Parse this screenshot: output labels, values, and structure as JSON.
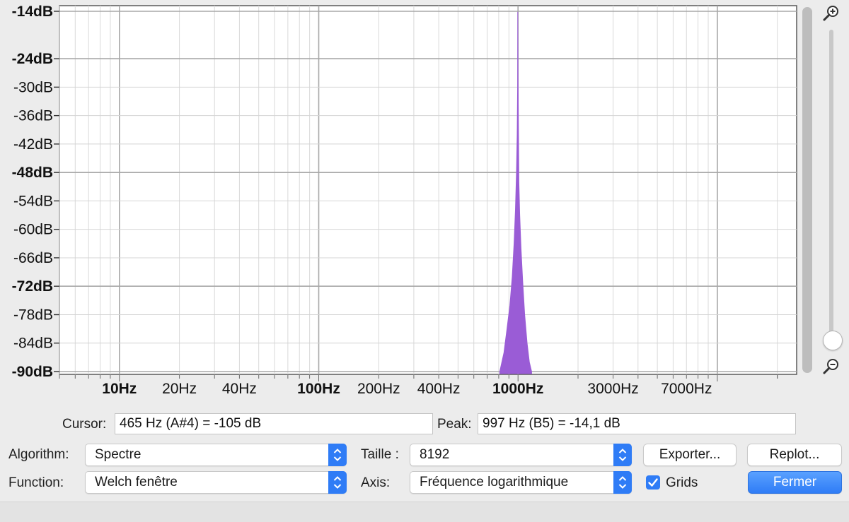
{
  "chart_data": {
    "type": "area",
    "x_scale": "log",
    "xlim": [
      5,
      25000
    ],
    "ylim": [
      -90,
      -14
    ],
    "grid": true,
    "y_tick_labels": [
      {
        "value": -14,
        "label": "-14dB",
        "major": true
      },
      {
        "value": -24,
        "label": "-24dB",
        "major": true
      },
      {
        "value": -30,
        "label": "-30dB",
        "major": false
      },
      {
        "value": -36,
        "label": "-36dB",
        "major": false
      },
      {
        "value": -42,
        "label": "-42dB",
        "major": false
      },
      {
        "value": -48,
        "label": "-48dB",
        "major": true
      },
      {
        "value": -54,
        "label": "-54dB",
        "major": false
      },
      {
        "value": -60,
        "label": "-60dB",
        "major": false
      },
      {
        "value": -66,
        "label": "-66dB",
        "major": false
      },
      {
        "value": -72,
        "label": "-72dB",
        "major": true
      },
      {
        "value": -78,
        "label": "-78dB",
        "major": false
      },
      {
        "value": -84,
        "label": "-84dB",
        "major": false
      },
      {
        "value": -90,
        "label": "-90dB",
        "major": true
      }
    ],
    "x_tick_labels": [
      {
        "value": 10,
        "label": "10Hz",
        "major": true
      },
      {
        "value": 20,
        "label": "20Hz",
        "major": false
      },
      {
        "value": 40,
        "label": "40Hz",
        "major": false
      },
      {
        "value": 100,
        "label": "100Hz",
        "major": true
      },
      {
        "value": 200,
        "label": "200Hz",
        "major": false
      },
      {
        "value": 400,
        "label": "400Hz",
        "major": false
      },
      {
        "value": 1000,
        "label": "1000Hz",
        "major": true
      },
      {
        "value": 3000,
        "label": "3000Hz",
        "major": false
      },
      {
        "value": 7000,
        "label": "7000Hz",
        "major": false
      }
    ],
    "spectrum_points": [
      {
        "x": 810,
        "y": -90
      },
      {
        "x": 850,
        "y": -86
      },
      {
        "x": 880,
        "y": -81
      },
      {
        "x": 910,
        "y": -76
      },
      {
        "x": 935,
        "y": -70
      },
      {
        "x": 955,
        "y": -63
      },
      {
        "x": 970,
        "y": -56
      },
      {
        "x": 982,
        "y": -48
      },
      {
        "x": 990,
        "y": -40
      },
      {
        "x": 995,
        "y": -30
      },
      {
        "x": 997,
        "y": -14.1
      },
      {
        "x": 1000,
        "y": -28
      },
      {
        "x": 1004,
        "y": -37
      },
      {
        "x": 1010,
        "y": -50
      },
      {
        "x": 1020,
        "y": -57
      },
      {
        "x": 1035,
        "y": -64
      },
      {
        "x": 1055,
        "y": -71
      },
      {
        "x": 1080,
        "y": -78
      },
      {
        "x": 1110,
        "y": -84
      },
      {
        "x": 1140,
        "y": -88
      },
      {
        "x": 1170,
        "y": -90
      }
    ],
    "series_color": "#9a5cd6"
  },
  "readout": {
    "cursor_label": "Cursor:",
    "cursor_value": "465 Hz (A#4) = -105 dB",
    "peak_label": "Peak:",
    "peak_value": "997 Hz (B5) = -14,1 dB"
  },
  "controls": {
    "algorithm_label": "Algorithm:",
    "algorithm_value": "Spectre",
    "function_label": "Function:",
    "function_value": "Welch fenêtre",
    "size_label": "Taille :",
    "size_value": "8192",
    "axis_label": "Axis:",
    "axis_value": "Fréquence logarithmique",
    "export_label": "Exporter...",
    "replot_label": "Replot...",
    "grids_label": "Grids",
    "grids_checked": true,
    "close_label": "Fermer"
  },
  "icons": {
    "zoom_in": "zoom-in-icon",
    "zoom_out": "zoom-out-icon"
  },
  "colors": {
    "accent": "#2f7cf6"
  }
}
